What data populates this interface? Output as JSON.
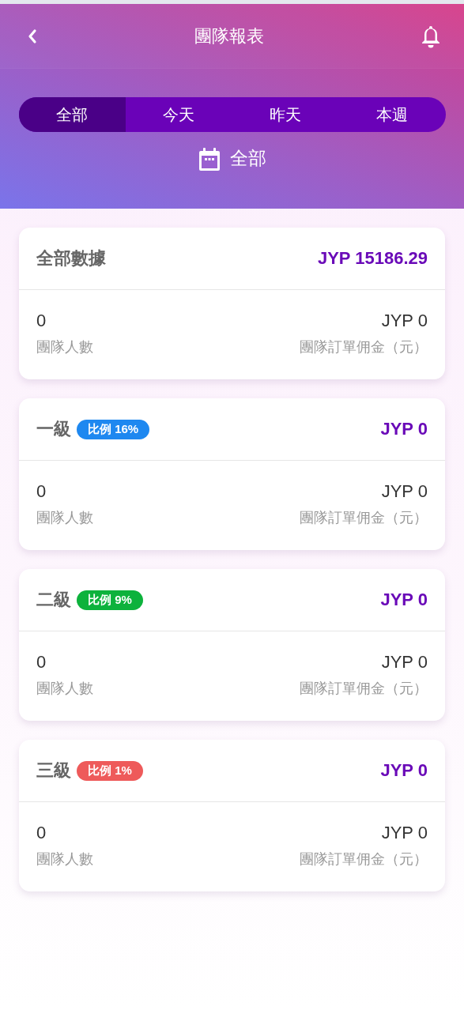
{
  "header": {
    "title": "團隊報表"
  },
  "tabs": [
    {
      "label": "全部",
      "selected": true
    },
    {
      "label": "今天",
      "selected": false
    },
    {
      "label": "昨天",
      "selected": false
    },
    {
      "label": "本週",
      "selected": false
    }
  ],
  "period": {
    "label": "全部"
  },
  "cards": [
    {
      "title": "全部數據",
      "amount": "JYP 15186.29",
      "members": "0",
      "members_label": "團隊人數",
      "commission": "JYP 0",
      "commission_label": "團隊訂單佣金（元）"
    },
    {
      "title": "一級",
      "badge": {
        "text": "比例 16%",
        "color": "#1e88f0"
      },
      "amount": "JYP 0",
      "members": "0",
      "members_label": "團隊人數",
      "commission": "JYP 0",
      "commission_label": "團隊訂單佣金（元）"
    },
    {
      "title": "二級",
      "badge": {
        "text": "比例 9%",
        "color": "#0db23c"
      },
      "amount": "JYP 0",
      "members": "0",
      "members_label": "團隊人數",
      "commission": "JYP 0",
      "commission_label": "團隊訂單佣金（元）"
    },
    {
      "title": "三級",
      "badge": {
        "text": "比例 1%",
        "color": "#ee5a5a"
      },
      "amount": "JYP 0",
      "members": "0",
      "members_label": "團隊人數",
      "commission": "JYP 0",
      "commission_label": "團隊訂單佣金（元）"
    }
  ]
}
